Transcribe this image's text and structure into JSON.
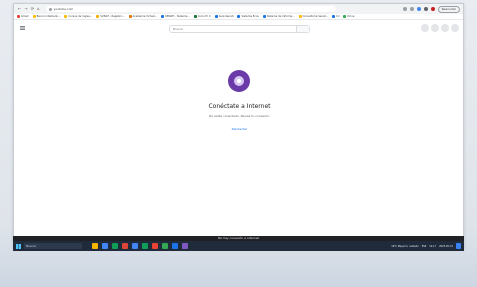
{
  "browser": {
    "url": "youtube.com",
    "resume_button": "Reanudar",
    "bookmarks": [
      {
        "label": "Gmail",
        "color": "#ea4335"
      },
      {
        "label": "Banco Interbank...",
        "color": "#fbbc04"
      },
      {
        "label": "Cursos de Ingles...",
        "color": "#fbbc04"
      },
      {
        "label": "SUNAT - Registro...",
        "color": "#f9ab00"
      },
      {
        "label": "Academia Virtual...",
        "color": "#e37400"
      },
      {
        "label": "SENATI - Sistema...",
        "color": "#1a73e8"
      },
      {
        "label": "Inicio Pr X",
        "color": "#137333"
      },
      {
        "label": "Aula Senati",
        "color": "#1a73e8"
      },
      {
        "label": "Sistema Ecos",
        "color": "#1a73e8"
      },
      {
        "label": "Sistema de Informa...",
        "color": "#1a73e8"
      },
      {
        "label": "Consultoria Senat...",
        "color": "#fbbc04"
      },
      {
        "label": "Cil",
        "color": "#1a73e8"
      },
      {
        "label": "Drive",
        "color": "#34a853"
      }
    ]
  },
  "page": {
    "search_placeholder": "Buscar",
    "offline_title": "Conéctate a Internet",
    "offline_message": "No estás conectado. Revisa tu conexión.",
    "retry_label": "Reintentar",
    "offline_bar": "No hay conexión a Internet"
  },
  "taskbar": {
    "search_placeholder": "Buscar",
    "weather": "19°C  Mayorm. nublado",
    "language": "ESP",
    "time": "12:17",
    "date": "2023-05-31",
    "app_colors": [
      "#f4b400",
      "#4285f4",
      "#0f9d58",
      "#db4437",
      "#4285f4",
      "#0f9d58",
      "#ea4335",
      "#34a853",
      "#1a73e8",
      "#7e57c2"
    ]
  },
  "colors": {
    "accent": "#1a73e8",
    "dino_bg": "#6a3aa8"
  }
}
